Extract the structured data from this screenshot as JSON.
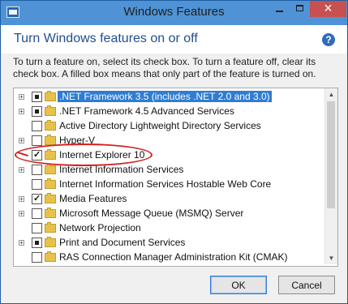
{
  "window": {
    "title": "Windows Features",
    "heading": "Turn Windows features on or off",
    "description": "To turn a feature on, select its check box. To turn a feature off, clear its check box. A filled box means that only part of the feature is turned on."
  },
  "features": [
    {
      "label": ".NET Framework 3.5 (includes .NET 2.0 and 3.0)",
      "state": "partial",
      "expandable": true,
      "selected": true
    },
    {
      "label": ".NET Framework 4.5 Advanced Services",
      "state": "partial",
      "expandable": true,
      "selected": false
    },
    {
      "label": "Active Directory Lightweight Directory Services",
      "state": "unchecked",
      "expandable": false,
      "selected": false
    },
    {
      "label": "Hyper-V",
      "state": "unchecked",
      "expandable": true,
      "selected": false
    },
    {
      "label": "Internet Explorer 10",
      "state": "checked",
      "expandable": false,
      "selected": false
    },
    {
      "label": "Internet Information Services",
      "state": "unchecked",
      "expandable": true,
      "selected": false
    },
    {
      "label": "Internet Information Services Hostable Web Core",
      "state": "unchecked",
      "expandable": false,
      "selected": false
    },
    {
      "label": "Media Features",
      "state": "checked",
      "expandable": true,
      "selected": false
    },
    {
      "label": "Microsoft Message Queue (MSMQ) Server",
      "state": "unchecked",
      "expandable": true,
      "selected": false
    },
    {
      "label": "Network Projection",
      "state": "unchecked",
      "expandable": false,
      "selected": false
    },
    {
      "label": "Print and Document Services",
      "state": "partial",
      "expandable": true,
      "selected": false
    },
    {
      "label": "RAS Connection Manager Administration Kit (CMAK)",
      "state": "unchecked",
      "expandable": false,
      "selected": false
    }
  ],
  "buttons": {
    "ok": "OK",
    "cancel": "Cancel"
  },
  "icons": {
    "app": "windows-features-icon",
    "help": "help-icon",
    "folder": "folder-icon"
  },
  "colors": {
    "titlebar": "#4f93d6",
    "selection": "#2f7cd3",
    "annotation": "#d51f1f"
  }
}
